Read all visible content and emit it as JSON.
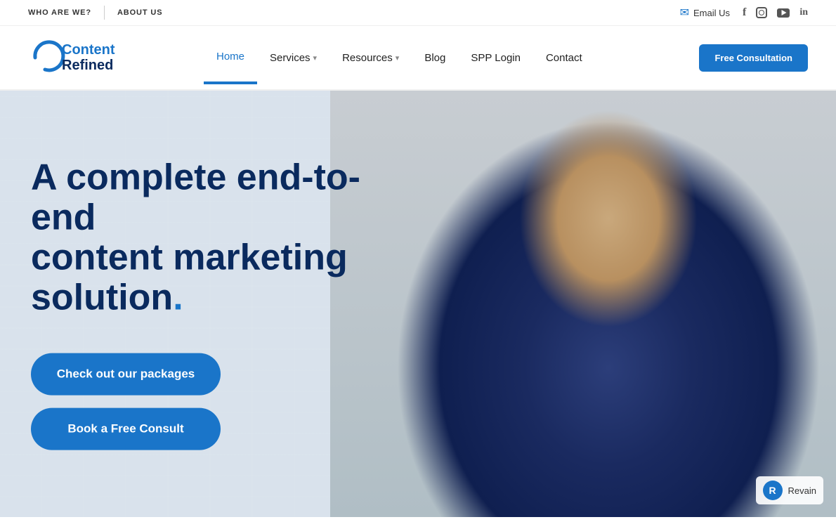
{
  "brand": {
    "name": "Content Refined",
    "logo_text_content": "Content Refined"
  },
  "topbar": {
    "link1": "WHO ARE WE?",
    "link2": "ABOUT US",
    "email_label": "Email Us",
    "social": {
      "facebook": "f",
      "instagram": "ig",
      "youtube": "yt",
      "linkedin": "in"
    }
  },
  "nav": {
    "links": [
      {
        "label": "Home",
        "active": true,
        "has_chevron": false
      },
      {
        "label": "Services",
        "active": false,
        "has_chevron": true
      },
      {
        "label": "Resources",
        "active": false,
        "has_chevron": true
      },
      {
        "label": "Blog",
        "active": false,
        "has_chevron": false
      },
      {
        "label": "SPP Login",
        "active": false,
        "has_chevron": false
      },
      {
        "label": "Contact",
        "active": false,
        "has_chevron": false
      }
    ],
    "cta_button": "Free Consultation"
  },
  "hero": {
    "title_line1": "A complete end-to-end",
    "title_line2": "content marketing",
    "title_line3": "solution",
    "title_dot": ".",
    "btn_packages": "Check out our packages",
    "btn_consult": "Book a Free Consult"
  },
  "revain": {
    "label": "Revain"
  }
}
